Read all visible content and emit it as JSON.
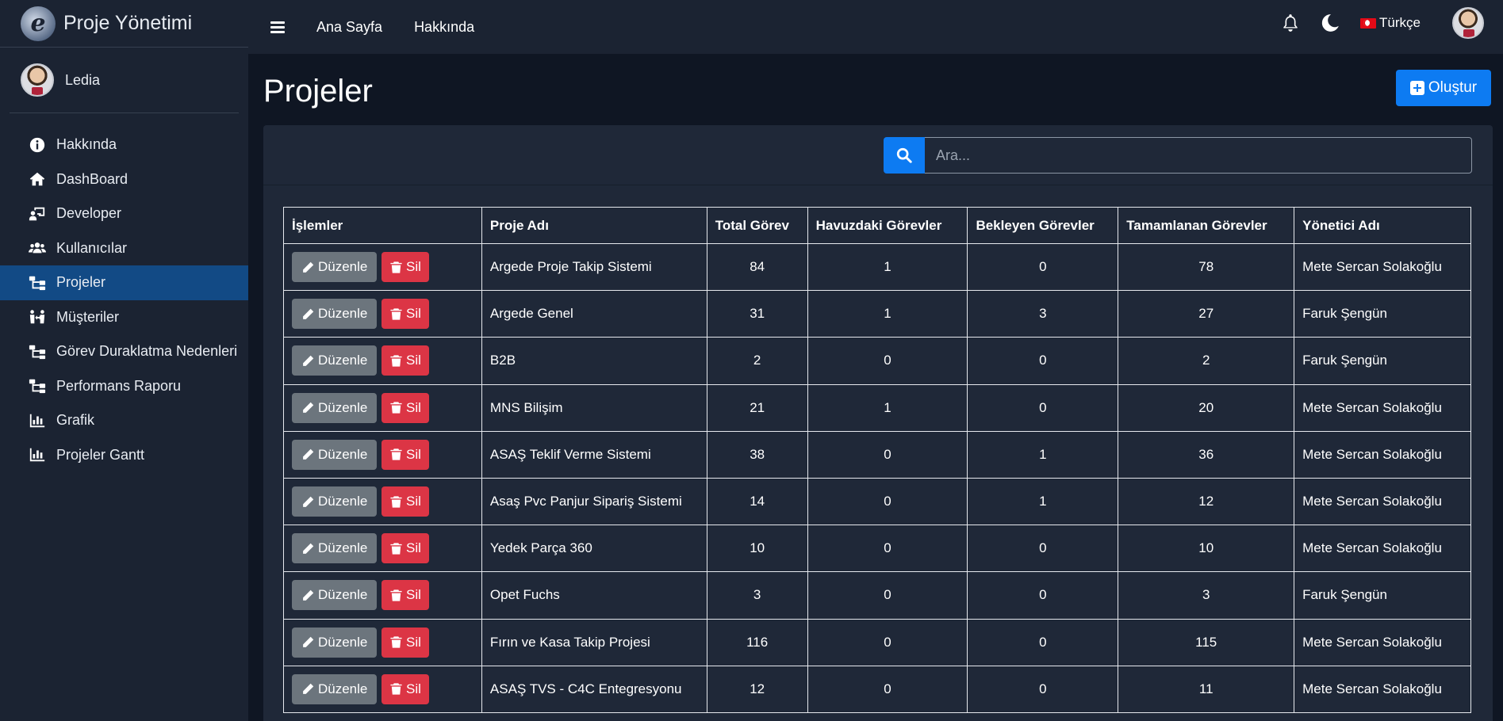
{
  "brand": {
    "title": "Proje Yönetimi"
  },
  "user": {
    "name": "Ledia"
  },
  "sidebar": {
    "items": [
      {
        "label": "Hakkında",
        "icon": "info-circle-icon",
        "active": false
      },
      {
        "label": "DashBoard",
        "icon": "home-icon",
        "active": false
      },
      {
        "label": "Developer",
        "icon": "chalkboard-user-icon",
        "active": false
      },
      {
        "label": "Kullanıcılar",
        "icon": "users-icon",
        "active": false
      },
      {
        "label": "Projeler",
        "icon": "sitemap-icon",
        "active": true
      },
      {
        "label": "Müşteriler",
        "icon": "people-arrows-icon",
        "active": false
      },
      {
        "label": "Görev Duraklatma Nedenleri",
        "icon": "sitemap-icon",
        "active": false
      },
      {
        "label": "Performans Raporu",
        "icon": "sitemap-icon",
        "active": false
      },
      {
        "label": "Grafik",
        "icon": "chart-bar-icon",
        "active": false
      },
      {
        "label": "Projeler Gantt",
        "icon": "chart-bar-icon",
        "active": false
      }
    ]
  },
  "topbar": {
    "links": [
      "Ana Sayfa",
      "Hakkında"
    ],
    "language": "Türkçe"
  },
  "page": {
    "title": "Projeler",
    "create_label": "Oluştur"
  },
  "search": {
    "placeholder": "Ara..."
  },
  "table": {
    "headers": [
      "İşlemler",
      "Proje Adı",
      "Total Görev",
      "Havuzdaki Görevler",
      "Bekleyen Görevler",
      "Tamamlanan Görevler",
      "Yönetici Adı"
    ],
    "edit_label": "Düzenle",
    "delete_label": "Sil",
    "rows": [
      {
        "name": "Argede Proje Takip Sistemi",
        "total": "84",
        "pool": "1",
        "pending": "0",
        "done": "78",
        "manager": "Mete Sercan Solakoğlu"
      },
      {
        "name": "Argede Genel",
        "total": "31",
        "pool": "1",
        "pending": "3",
        "done": "27",
        "manager": "Faruk Şengün"
      },
      {
        "name": "B2B",
        "total": "2",
        "pool": "0",
        "pending": "0",
        "done": "2",
        "manager": "Faruk Şengün"
      },
      {
        "name": "MNS Bilişim",
        "total": "21",
        "pool": "1",
        "pending": "0",
        "done": "20",
        "manager": "Mete Sercan Solakoğlu"
      },
      {
        "name": "ASAŞ Teklif Verme Sistemi",
        "total": "38",
        "pool": "0",
        "pending": "1",
        "done": "36",
        "manager": "Mete Sercan Solakoğlu"
      },
      {
        "name": "Asaş Pvc Panjur Sipariş Sistemi",
        "total": "14",
        "pool": "0",
        "pending": "1",
        "done": "12",
        "manager": "Mete Sercan Solakoğlu"
      },
      {
        "name": "Yedek Parça 360",
        "total": "10",
        "pool": "0",
        "pending": "0",
        "done": "10",
        "manager": "Mete Sercan Solakoğlu"
      },
      {
        "name": "Opet Fuchs",
        "total": "3",
        "pool": "0",
        "pending": "0",
        "done": "3",
        "manager": "Faruk Şengün"
      },
      {
        "name": "Fırın ve Kasa Takip Projesi",
        "total": "116",
        "pool": "0",
        "pending": "0",
        "done": "115",
        "manager": "Mete Sercan Solakoğlu"
      },
      {
        "name": "ASAŞ TVS - C4C Entegresyonu",
        "total": "12",
        "pool": "0",
        "pending": "0",
        "done": "11",
        "manager": "Mete Sercan Solakoğlu"
      }
    ]
  },
  "colors": {
    "sidebar_bg": "#1b2332",
    "active_item": "#124a85",
    "primary": "#0d7bf2",
    "danger": "#dc3545",
    "secondary": "#6c757d",
    "card_bg": "#1f2838",
    "page_bg": "#0f1623"
  }
}
